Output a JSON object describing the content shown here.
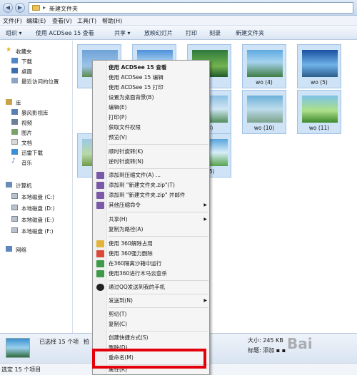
{
  "address": {
    "path": "新建文件夹"
  },
  "menubar": [
    "文件(F)",
    "编辑(E)",
    "查看(V)",
    "工具(T)",
    "帮助(H)"
  ],
  "toolbar": [
    "组织 ▾",
    "使用 ACDSee 15 查看",
    "共享 ▾",
    "放映幻灯片",
    "打印",
    "刻录",
    "新建文件夹"
  ],
  "sidebar": {
    "favorites": "收藏夹",
    "fav_items": [
      "下载",
      "桌面",
      "最近访问的位置"
    ],
    "library": "库",
    "lib_items": [
      "暴风影视库",
      "视频",
      "图片",
      "文档",
      "迅雷下载",
      "音乐"
    ],
    "computer": "计算机",
    "drives": [
      "本地磁盘 (C:)",
      "本地磁盘 (D:)",
      "本地磁盘 (E:)",
      "本地磁盘 (F:)"
    ],
    "network": "网络"
  },
  "thumbs": [
    {
      "caption": ""
    },
    {
      "caption": ""
    },
    {
      "caption": ""
    },
    {
      "caption": "wo (4)"
    },
    {
      "caption": "wo (5)"
    },
    {
      "caption": "(3)"
    },
    {
      "caption": "wo (10)"
    },
    {
      "caption": "wo (11)"
    },
    {
      "caption": "(9"
    },
    {
      "caption": "(15)"
    }
  ],
  "context_menu": {
    "items": [
      "使用 ACDSee 15 查看",
      "使用 ACDSee 15 编辑",
      "使用 ACDSee 15 打印",
      "设置为桌面背景(B)",
      "编辑(E)",
      "打印(P)",
      "获取文件权限",
      "预览(V)",
      "顺时针旋转(K)",
      "逆时针旋转(N)",
      "添加到压缩文件(A) ...",
      "添加到 \"新建文件夹.zip\"(T)",
      "添加到 \"新建文件夹.zip\" 并邮件",
      "其他压缩命令",
      "共享(H)",
      "复制为路径(A)",
      "使用 360解除占用",
      "使用 360强力删除",
      "在360隔离沙箱中运行",
      "使用360进行木马云查杀",
      "通过QQ发送到我的手机",
      "发送到(N)",
      "剪切(T)",
      "复制(C)",
      "创建快捷方式(S)",
      "删除(D)",
      "重命名(M)",
      "属性(R)"
    ]
  },
  "details": {
    "selected": "已选择 15 个项",
    "shoot": "拍",
    "size_label": "大小: 245 KB",
    "tag_label": "标题: 添加 ▪ ▪"
  },
  "status": {
    "count": "选定 15 个项目"
  },
  "watermark": "Bai"
}
